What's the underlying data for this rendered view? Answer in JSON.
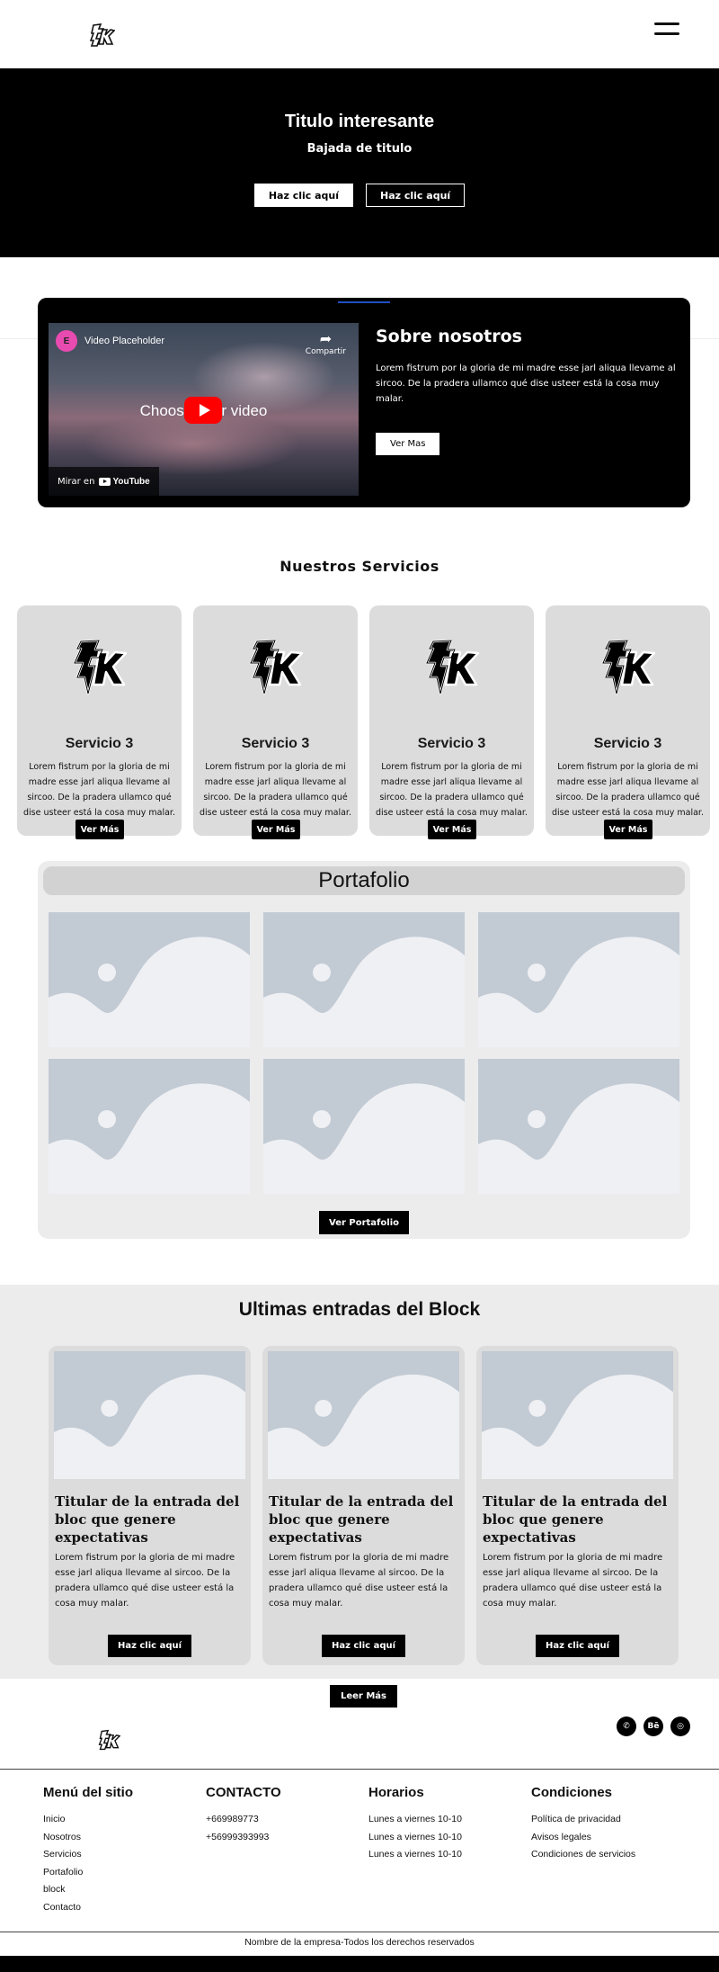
{
  "header": {
    "logo_icon": "fk-logo-icon",
    "menu_icon": "hamburger-menu-icon"
  },
  "hero": {
    "title": "Titulo interesante",
    "subtitle": "Bajada de titulo",
    "button_primary": "Haz clic aquí",
    "button_secondary": "Haz clic aquí"
  },
  "about": {
    "video": {
      "channel_icon": "elementor-icon",
      "title": "Video Placeholder",
      "share_label": "Compartir",
      "center_text": "Choose your video",
      "watch_on": "Mirar en",
      "youtube_label": "YouTube"
    },
    "title": "Sobre nosotros",
    "text": "Lorem fistrum por la gloria de mi madre esse jarl aliqua llevame al sircoo. De la pradera ullamco qué dise usteer está la cosa muy malar.",
    "button": "Ver Mas"
  },
  "services": {
    "title": "Nuestros Servicios",
    "items": [
      {
        "title": "Servicio 3",
        "text": "Lorem fistrum por la gloria de mi madre esse jarl aliqua llevame al sircoo. De la pradera ullamco qué dise usteer está la cosa muy malar.",
        "button": "Ver Más"
      },
      {
        "title": "Servicio 3",
        "text": "Lorem fistrum por la gloria de mi madre esse jarl aliqua llevame al sircoo. De la pradera ullamco qué dise usteer está la cosa muy malar.",
        "button": "Ver Más"
      },
      {
        "title": "Servicio 3",
        "text": "Lorem fistrum por la gloria de mi madre esse jarl aliqua llevame al sircoo. De la pradera ullamco qué dise usteer está la cosa muy malar.",
        "button": "Ver Más"
      },
      {
        "title": "Servicio 3",
        "text": "Lorem fistrum por la gloria de mi madre esse jarl aliqua llevame al sircoo. De la pradera ullamco qué dise usteer está la cosa muy malar.",
        "button": "Ver Más"
      }
    ]
  },
  "portfolio": {
    "title": "Portafolio",
    "button": "Ver Portafolio"
  },
  "blog": {
    "title": "Ultimas entradas del Block",
    "posts": [
      {
        "title": "Titular de la entrada del bloc que genere expectativas",
        "text": "Lorem fistrum por la gloria de mi madre esse jarl aliqua llevame al sircoo. De la pradera ullamco qué dise usteer está la cosa muy malar.",
        "button": "Haz clic aquí"
      },
      {
        "title": "Titular de la entrada del bloc que genere expectativas",
        "text": "Lorem fistrum por la gloria de mi madre esse jarl aliqua llevame al sircoo. De la pradera ullamco qué dise usteer está la cosa muy malar.",
        "button": "Haz clic aquí"
      },
      {
        "title": "Titular de la entrada del bloc que genere expectativas",
        "text": "Lorem fistrum por la gloria de mi madre esse jarl aliqua llevame al sircoo. De la pradera ullamco qué dise usteer está la cosa muy malar.",
        "button": "Haz clic aquí"
      }
    ],
    "read_more": "Leer Más"
  },
  "footer": {
    "social": [
      {
        "icon": "whatsapp-icon",
        "glyph": "✆"
      },
      {
        "icon": "behance-icon",
        "glyph": "Bē"
      },
      {
        "icon": "instagram-icon",
        "glyph": "◎"
      }
    ],
    "columns": [
      {
        "title": "Menú del sitio",
        "items": [
          "Inicio",
          "Nosotros",
          "Servicios",
          "Portafolio",
          "block",
          "Contacto"
        ]
      },
      {
        "title": "CONTACTO",
        "items": [
          "+669989773",
          "+56999393993"
        ]
      },
      {
        "title": "Horarios",
        "items": [
          "Lunes a viernes 10-10",
          "Lunes a viernes 10-10",
          "Lunes a viernes 10-10"
        ]
      },
      {
        "title": "Condiciones",
        "items": [
          "Política de privacidad",
          "Avisos legales",
          "Condiciones de servicios"
        ]
      }
    ],
    "copyright": "Nombre de la empresa-Todos los derechos reservados"
  }
}
